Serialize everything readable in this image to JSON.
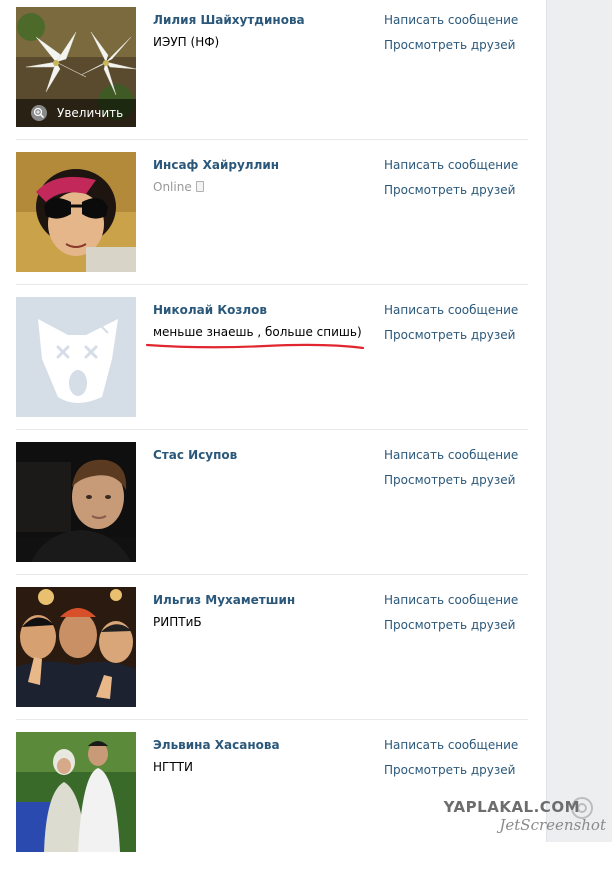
{
  "friends": [
    {
      "name": "Лилия Шайхутдинова",
      "subtitle": "ИЭУП (НФ)",
      "write_label": "Написать сообщение",
      "friends_label": "Просмотреть друзей",
      "zoom_label": "Увеличить"
    },
    {
      "name": "Инсаф Хайруллин",
      "subtitle": "Online",
      "write_label": "Написать сообщение",
      "friends_label": "Просмотреть друзей"
    },
    {
      "name": "Николай Козлов",
      "subtitle": "меньше знаешь , больше спишь)",
      "write_label": "Написать сообщение",
      "friends_label": "Просмотреть друзей"
    },
    {
      "name": "Стас Исупов",
      "subtitle": "",
      "write_label": "Написать сообщение",
      "friends_label": "Просмотреть друзей"
    },
    {
      "name": "Ильгиз Мухаметшин",
      "subtitle": "РИПТиБ",
      "write_label": "Написать сообщение",
      "friends_label": "Просмотреть друзей"
    },
    {
      "name": "Эльвина Хасанова",
      "subtitle": "НГТТИ",
      "write_label": "Написать сообщение",
      "friends_label": "Просмотреть друзей"
    }
  ],
  "watermark": {
    "site": "YAPLAKAL.COM",
    "tool": "JetScreenshot"
  },
  "colors": {
    "link": "#2b587a",
    "muted": "#999999",
    "annotation": "#e0262f",
    "divider": "#e7e8ec"
  }
}
